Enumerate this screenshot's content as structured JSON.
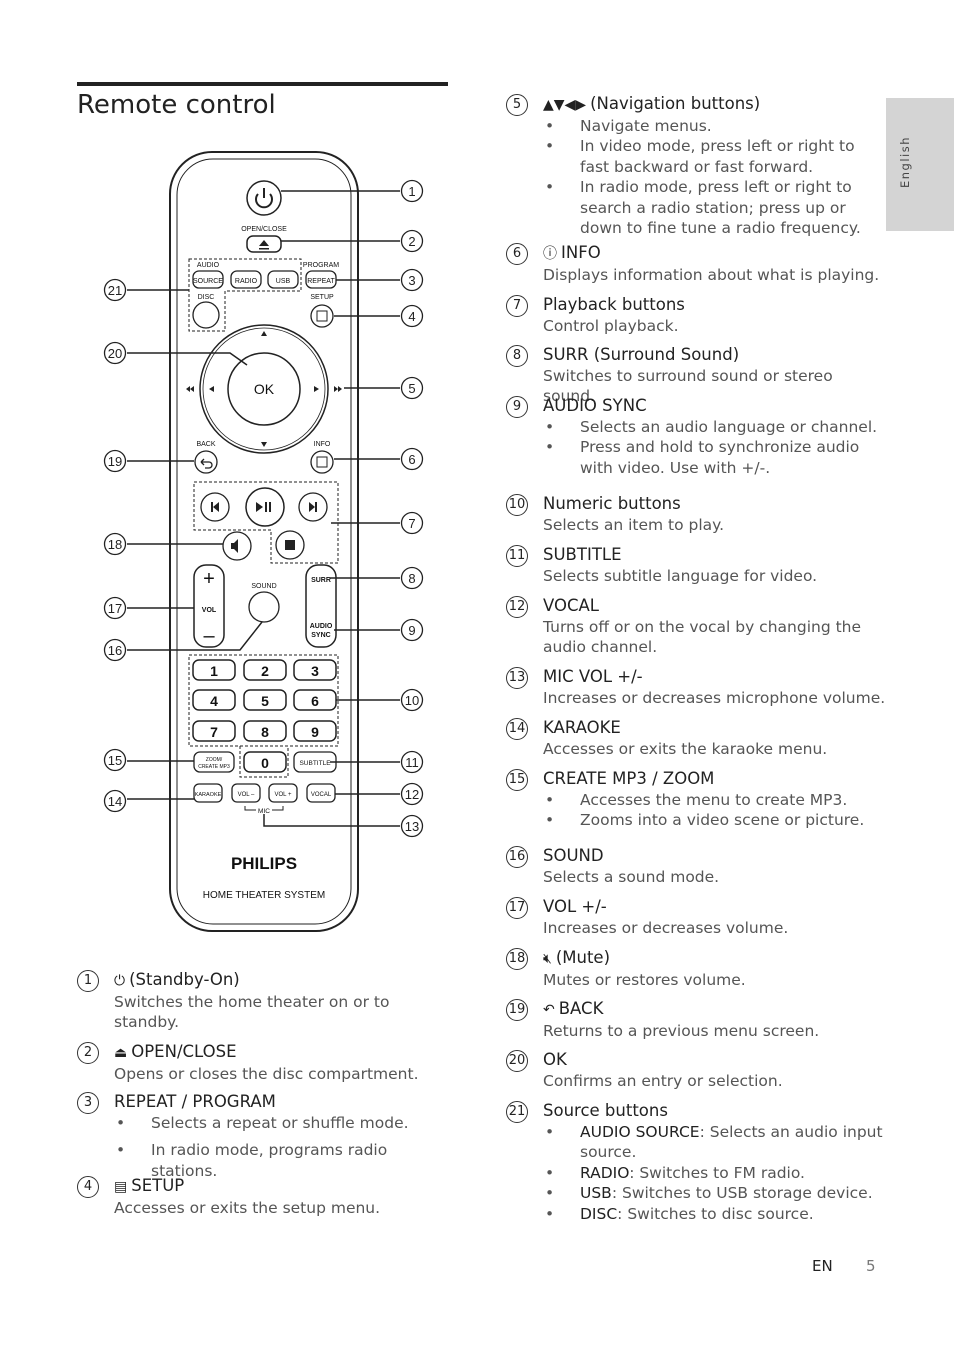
{
  "page": {
    "title": "Remote control",
    "side_tab": "English",
    "footer_lang": "EN",
    "page_number": "5"
  },
  "remote": {
    "open_close": "OPEN/CLOSE",
    "audio": "AUDIO",
    "source": "SOURCE",
    "radio": "RADIO",
    "usb": "USB",
    "program": "PROGRAM",
    "repeat": "REPEAT",
    "disc": "DISC",
    "setup": "SETUP",
    "ok": "OK",
    "back": "BACK",
    "info": "INFO",
    "sound": "SOUND",
    "vol": "VOL",
    "surr": "SURR",
    "audio2": "AUDIO",
    "sync": "SYNC",
    "digits": [
      "1",
      "2",
      "3",
      "4",
      "5",
      "6",
      "7",
      "8",
      "9"
    ],
    "zero": "0",
    "zoom1": "ZOOM/",
    "zoom2": "CREATE MP3",
    "subtitle": "SUBTITLE",
    "karaoke": "KARAOKE",
    "vol_minus": "VOL –",
    "vol_plus": "VOL +",
    "vocal": "VOCAL",
    "mic": "MIC",
    "brand": "PHILIPS",
    "product": "HOME THEATER SYSTEM",
    "callouts_right": [
      "1",
      "2",
      "3",
      "4",
      "5",
      "6",
      "7",
      "8",
      "9",
      "10",
      "11",
      "12",
      "13"
    ],
    "callouts_left": [
      "21",
      "20",
      "19",
      "18",
      "17",
      "16",
      "15",
      "14"
    ]
  },
  "items": [
    {
      "n": "1",
      "icon": "power-icon",
      "glyph": "⏻",
      "title": "(Standby-On)",
      "body": "Switches the home theater on or to standby."
    },
    {
      "n": "2",
      "icon": "eject-icon",
      "glyph": "⏏",
      "title": "OPEN/CLOSE",
      "body": "Opens or closes the disc compartment."
    },
    {
      "n": "3",
      "title": "REPEAT / PROGRAM",
      "bullets": [
        {
          "text": "Selects a repeat or shuffle mode."
        },
        {
          "text": "In radio mode, programs radio stations."
        }
      ]
    },
    {
      "n": "4",
      "icon": "setup-icon",
      "glyph": "▤",
      "title": "SETUP",
      "body": "Accesses or exits the setup menu."
    },
    {
      "n": "5",
      "icon": "navigation-arrows-icon",
      "glyph": "▲▼◀▶",
      "title": "(Navigation buttons)",
      "bullets": [
        {
          "text": "Navigate menus."
        },
        {
          "text": "In video mode, press left or right to fast backward or fast forward."
        },
        {
          "text": "In radio mode, press left or right to search a radio station; press up or down to fine tune a radio frequency."
        }
      ]
    },
    {
      "n": "6",
      "icon": "info-icon",
      "glyph": "ⓘ",
      "title": "INFO",
      "body": "Displays information about what is playing."
    },
    {
      "n": "7",
      "title": "Playback buttons",
      "body": "Control playback."
    },
    {
      "n": "8",
      "title": "SURR (Surround Sound)",
      "body": "Switches to surround sound or stereo sound."
    },
    {
      "n": "9",
      "title": "AUDIO SYNC",
      "bullets": [
        {
          "text": "Selects an audio language or channel."
        },
        {
          "text": "Press and hold to synchronize audio with video. Use with +/-."
        }
      ]
    },
    {
      "n": "10",
      "title": "Numeric buttons",
      "body": "Selects an item to play."
    },
    {
      "n": "11",
      "title": "SUBTITLE",
      "body": "Selects subtitle language for video."
    },
    {
      "n": "12",
      "title": "VOCAL",
      "body": "Turns off or on the vocal by changing the audio channel."
    },
    {
      "n": "13",
      "title": "MIC VOL +/-",
      "body": "Increases or decreases microphone volume."
    },
    {
      "n": "14",
      "title": "KARAOKE",
      "body": "Accesses or exits the karaoke menu."
    },
    {
      "n": "15",
      "title": "CREATE MP3 / ZOOM",
      "bullets": [
        {
          "text": "Accesses the menu to create MP3."
        },
        {
          "text": "Zooms into a video scene or picture."
        }
      ]
    },
    {
      "n": "16",
      "title": "SOUND",
      "body": "Selects a sound mode."
    },
    {
      "n": "17",
      "title": "VOL +/-",
      "body": "Increases or decreases volume."
    },
    {
      "n": "18",
      "icon": "mute-icon",
      "glyph": "🔇︎",
      "title": "(Mute)",
      "body": "Mutes or restores volume."
    },
    {
      "n": "19",
      "icon": "back-icon",
      "glyph": "↶",
      "title": "BACK",
      "body": "Returns to a previous menu screen."
    },
    {
      "n": "20",
      "title": "OK",
      "body": "Confirms an entry or selection."
    },
    {
      "n": "21",
      "title": "Source buttons",
      "bullets": [
        {
          "label": "AUDIO SOURCE",
          "text": ": Selects an audio input source."
        },
        {
          "label": "RADIO",
          "text": ": Switches to FM radio."
        },
        {
          "label": "USB",
          "text": ": Switches to USB storage device."
        },
        {
          "label": "DISC",
          "text": ": Switches to disc source."
        }
      ]
    }
  ]
}
